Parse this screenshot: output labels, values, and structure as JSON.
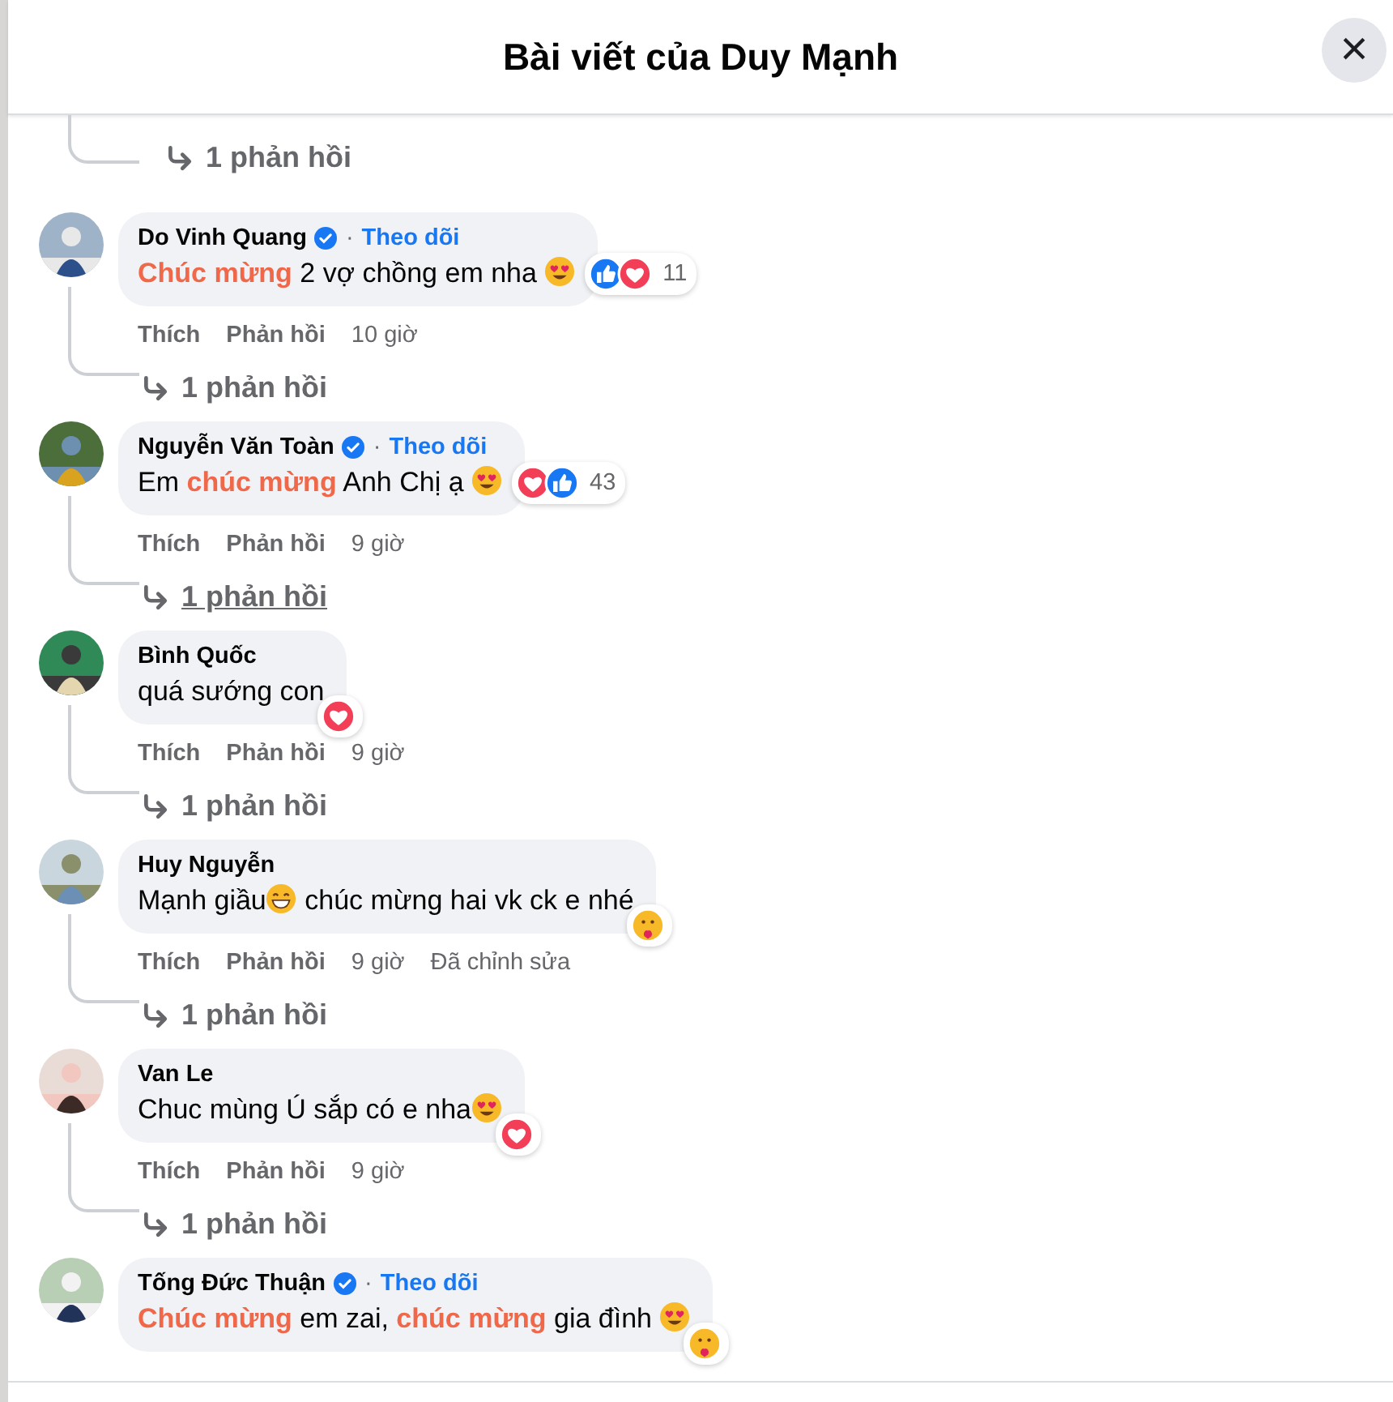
{
  "header": {
    "title": "Bài viết của Duy Mạnh",
    "close_label": "×"
  },
  "top_replies": {
    "label": "1 phản hồi",
    "hovered": false
  },
  "comments": [
    {
      "name": "Do Vinh Quang",
      "verified": true,
      "follow": {
        "separator": "·",
        "label": "Theo dõi"
      },
      "segments": [
        {
          "kind": "accent",
          "text": "Chúc mừng"
        },
        {
          "kind": "text",
          "text": " 2 vợ chồng em nha "
        },
        {
          "kind": "heart-eyes"
        }
      ],
      "reactions": {
        "items": [
          {
            "kind": "like"
          },
          {
            "kind": "love"
          }
        ],
        "count": "11"
      },
      "actions": {
        "like": "Thích",
        "reply": "Phản hồi",
        "time": "10 giờ"
      },
      "replies": {
        "label": "1 phản hồi",
        "hovered": false
      }
    },
    {
      "name": "Nguyễn Văn Toàn",
      "verified": true,
      "follow": {
        "separator": "·",
        "label": "Theo dõi"
      },
      "segments": [
        {
          "kind": "text",
          "text": "Em "
        },
        {
          "kind": "accent",
          "text": "chúc mừng"
        },
        {
          "kind": "text",
          "text": " Anh Chị ạ "
        },
        {
          "kind": "heart-eyes"
        }
      ],
      "reactions": {
        "items": [
          {
            "kind": "love"
          },
          {
            "kind": "like"
          }
        ],
        "count": "43"
      },
      "actions": {
        "like": "Thích",
        "reply": "Phản hồi",
        "time": "9 giờ"
      },
      "replies": {
        "label": "1 phản hồi",
        "hovered": true
      }
    },
    {
      "name": "Bình Quốc",
      "verified": false,
      "segments": [
        {
          "kind": "text",
          "text": "quá sướng con"
        }
      ],
      "reactions": {
        "items": [
          {
            "kind": "love"
          }
        ]
      },
      "actions": {
        "like": "Thích",
        "reply": "Phản hồi",
        "time": "9 giờ"
      },
      "replies": {
        "label": "1 phản hồi",
        "hovered": false
      }
    },
    {
      "name": "Huy Nguyễn",
      "verified": false,
      "segments": [
        {
          "kind": "text",
          "text": "Mạnh giầu"
        },
        {
          "kind": "grin"
        },
        {
          "kind": "text",
          "text": " chúc mừng hai vk ck e nhé"
        }
      ],
      "reactions": {
        "items": [
          {
            "kind": "care"
          }
        ]
      },
      "actions": {
        "like": "Thích",
        "reply": "Phản hồi",
        "time": "9 giờ",
        "edited": "Đã chỉnh sửa"
      },
      "replies": {
        "label": "1 phản hồi",
        "hovered": false
      }
    },
    {
      "name": "Van Le",
      "verified": false,
      "segments": [
        {
          "kind": "text",
          "text": "Chuc mùng Ú sắp có e nha"
        },
        {
          "kind": "heart-eyes"
        }
      ],
      "reactions": {
        "items": [
          {
            "kind": "love"
          }
        ]
      },
      "actions": {
        "like": "Thích",
        "reply": "Phản hồi",
        "time": "9 giờ"
      },
      "replies": {
        "label": "1 phản hồi",
        "hovered": false
      }
    },
    {
      "name": "Tống Đức Thuận",
      "verified": true,
      "follow": {
        "separator": "·",
        "label": "Theo dõi"
      },
      "segments": [
        {
          "kind": "accent",
          "text": "Chúc mừng"
        },
        {
          "kind": "text",
          "text": " em zai, "
        },
        {
          "kind": "accent",
          "text": "chúc mừng"
        },
        {
          "kind": "text",
          "text": " gia đình "
        },
        {
          "kind": "heart-eyes"
        }
      ],
      "reactions": {
        "items": [
          {
            "kind": "care"
          }
        ]
      }
    }
  ]
}
